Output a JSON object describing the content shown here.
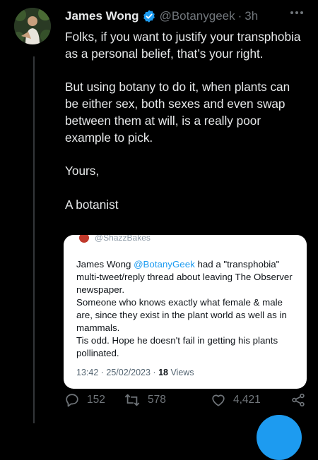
{
  "tweet": {
    "author_name": "James Wong",
    "handle": "@Botanygeek",
    "separator": "·",
    "time": "3h",
    "paragraphs": [
      "Folks, if you want to justify your transphobia as a personal belief, that’s your right.",
      "But using botany to do it, when plants can be either sex, both sexes and even swap between them at will, is a really poor example to pick.",
      "Yours,",
      "A botanist"
    ]
  },
  "quote": {
    "header_handle": "@ShazzBakes",
    "line1_prefix": "James Wong ",
    "line1_mention": "@BotanyGeek",
    "line1_suffix": " had a \"transphobia\" multi-tweet/reply thread about leaving The Observer newspaper.",
    "line2": "Someone who knows exactly what female & male are, since they exist in the plant world as well as in mammals.",
    "line3": "Tis odd. Hope he doesn't fail in getting his plants pollinated.",
    "meta_time": "13:42 · 25/02/2023 · ",
    "meta_views_count": "18",
    "meta_views_label": " Views"
  },
  "actions": {
    "replies": "152",
    "retweets": "578",
    "likes": "4,421"
  },
  "colors": {
    "background": "#000000",
    "text": "#e7e9ea",
    "muted": "#71767b",
    "accent": "#1d9bf0",
    "card": "#ffffff"
  },
  "icons": [
    "verified-badge-icon",
    "more-options-icon",
    "reply-icon",
    "retweet-icon",
    "like-icon",
    "share-icon",
    "compose-icon"
  ]
}
